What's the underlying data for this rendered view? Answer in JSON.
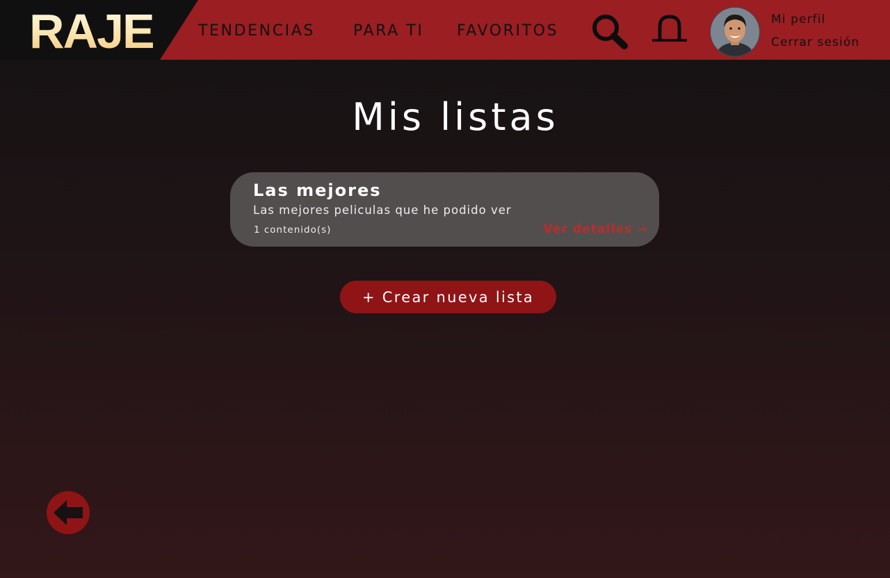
{
  "header": {
    "logo": "RAJE",
    "nav": [
      {
        "label": "TENDENCIAS"
      },
      {
        "label": "PARA TI"
      },
      {
        "label": "FAVORITOS"
      }
    ],
    "profile_label": "Mi perfil",
    "logout_label": "Cerrar sesión",
    "search_icon": "search-icon",
    "bell_icon": "bell-icon"
  },
  "main": {
    "title": "Mis listas",
    "lists": [
      {
        "name": "Las mejores",
        "description": "Las mejores peliculas que he podido ver",
        "count": "1 contenido(s)",
        "details_label": "Ver detalles →"
      }
    ],
    "create_label": "+ Crear nueva lista"
  },
  "back_icon": "arrow-left-icon",
  "colors": {
    "accent_red": "#9b1e22",
    "button_red": "#8f1416",
    "link_red": "#c62828",
    "card_bg": "#534e4e",
    "logo_cream": "#fce4b0"
  }
}
